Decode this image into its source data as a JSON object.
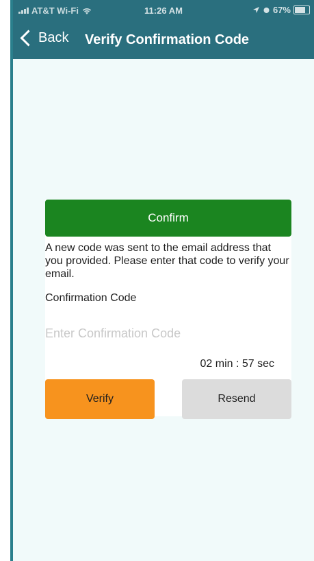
{
  "status_bar": {
    "carrier": "AT&T Wi-Fi",
    "time": "11:26 AM",
    "battery": "67%",
    "wifi_icon": "wifi-icon",
    "location_icon": "location-arrow-icon",
    "alarm_icon": "alarm-icon",
    "battery_level": 0.67
  },
  "nav": {
    "back_label": "Back",
    "title": "Verify Confirmation Code",
    "back_icon": "chevron-left-icon"
  },
  "card": {
    "header": "Confirm",
    "message": "A new code was sent to the email address that you provided.  Please enter that code to verify your email.",
    "code_label": "Confirmation Code",
    "code_placeholder": "Enter Confirmation Code",
    "code_value": "",
    "timer": "02 min : 57 sec",
    "verify_label": "Verify",
    "resend_label": "Resend"
  },
  "colors": {
    "nav_bg": "#2a6f7e",
    "content_bg": "#f1fafa",
    "confirm_green": "#1b8520",
    "verify_orange": "#f7931e",
    "resend_gray": "#dcdcdc"
  }
}
